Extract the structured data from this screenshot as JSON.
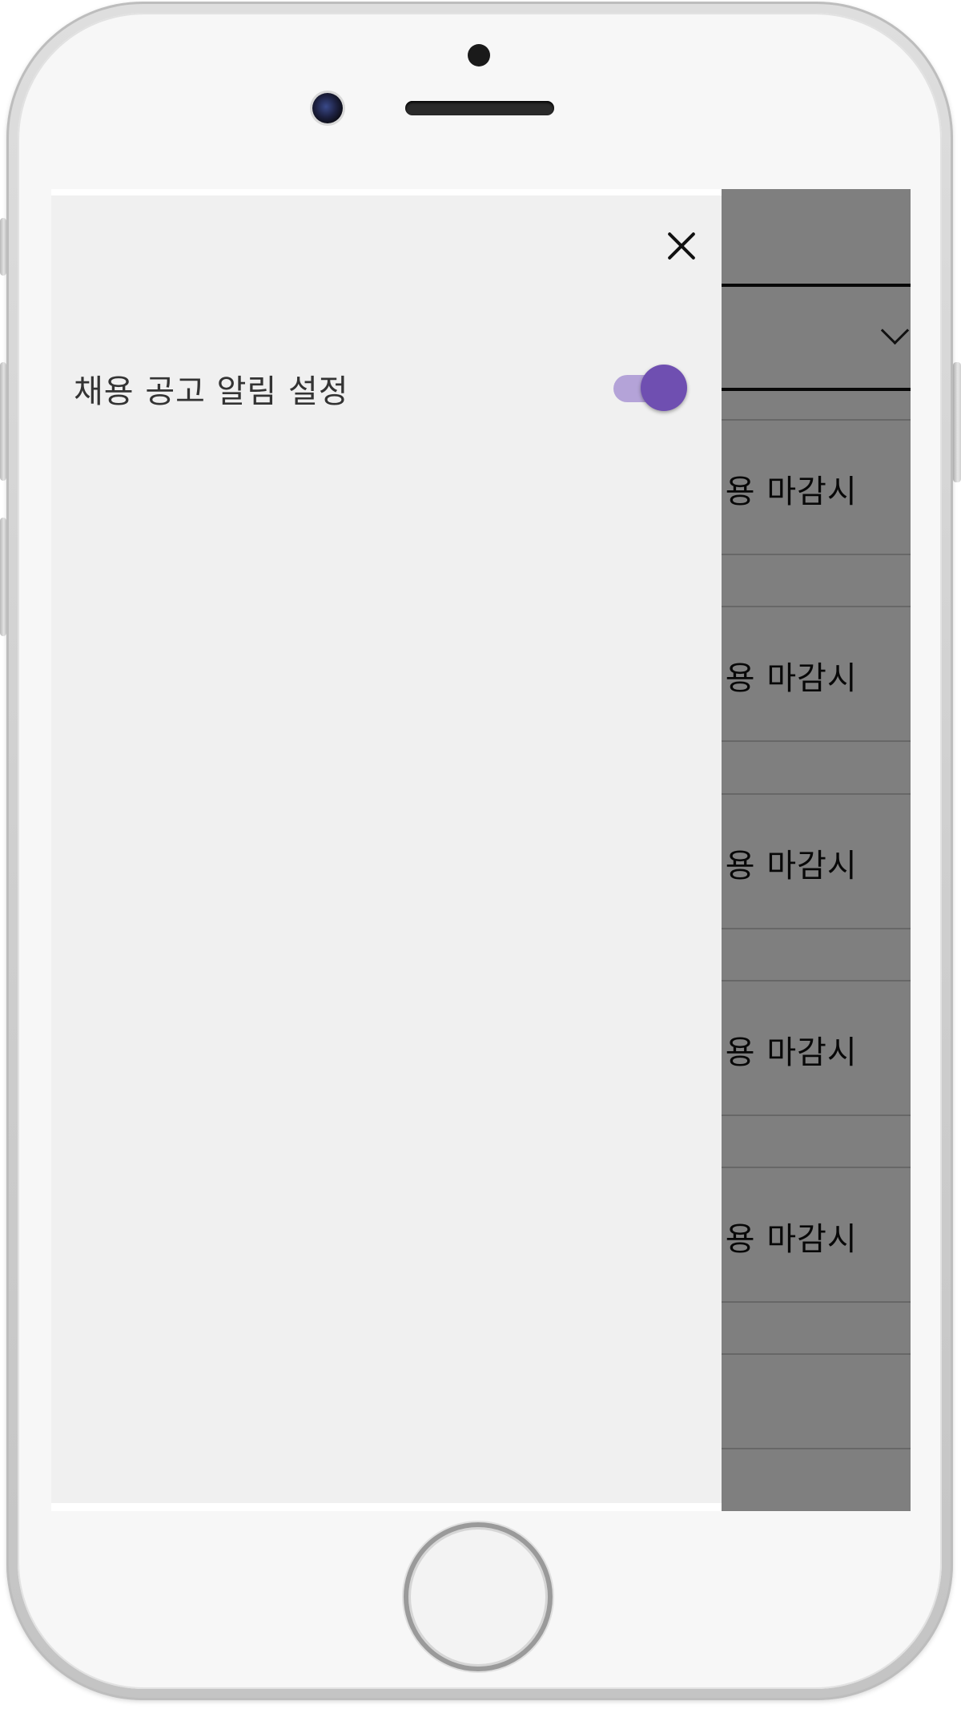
{
  "drawer": {
    "close_icon": "close-icon",
    "settings": [
      {
        "label": "채용 공고 알림 설정",
        "toggle_on": true
      }
    ]
  },
  "background": {
    "dropdown_icon": "chevron-down-icon",
    "job_cards": [
      {
        "deadline": "채용 마감시"
      },
      {
        "deadline": "채용 마감시"
      },
      {
        "deadline": "채용 마감시"
      },
      {
        "deadline": "채용 마감시"
      },
      {
        "deadline": "채용 마감시"
      }
    ]
  },
  "colors": {
    "toggle_thumb": "#6f4fb1",
    "toggle_track": "#b4a3d8",
    "drawer_background": "#f0f0f0",
    "scrim": "#000000"
  }
}
